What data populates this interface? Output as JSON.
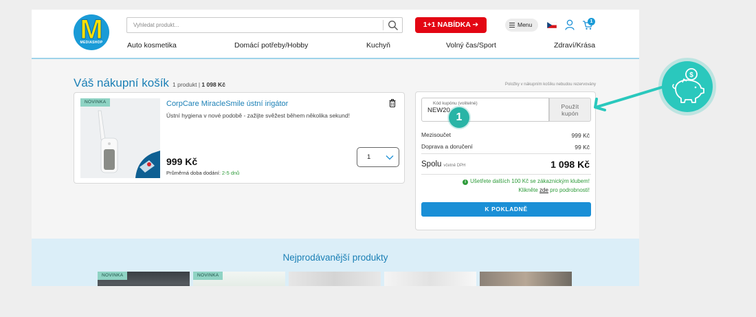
{
  "logo": {
    "letter": "M",
    "sub": "MEDIASHOP"
  },
  "search": {
    "placeholder": "Vyhledat produkt..."
  },
  "promo_label": "1+1 NABÍDKA ➔",
  "menu_label": "Menu",
  "cart_count": "1",
  "nav": [
    "Auto kosmetika",
    "Domácí potřeby/Hobby",
    "Kuchyň",
    "Volný čas/Sport",
    "Zdraví/Krása"
  ],
  "cart": {
    "title": "Váš nákupní košík",
    "count_text": "1 produkt",
    "count_sep": "|",
    "count_price": "1 098 Kč",
    "reserve_note": "Položky v nákupním košíku nebudou rezervovány"
  },
  "product": {
    "badge": "NOVINKA",
    "name": "CorpCare MiracleSmile ústní irigátor",
    "description": "Ústní hygiena v nové podobě - zažijte svěžest během několika sekund!",
    "price": "999 Kč",
    "delivery_label": "Průměrná doba dodání:",
    "delivery_value": "2-5 dnů",
    "quantity": "1"
  },
  "summary": {
    "coupon_label": "Kód kupónu (volitelné)",
    "coupon_value": "NEW20",
    "coupon_button_line1": "Použít",
    "coupon_button_line2": "kupón",
    "step_number": "1",
    "subtotal_label": "Mezisoučet",
    "subtotal_value": "999 Kč",
    "shipping_label": "Doprava a doručení",
    "shipping_value": "99 Kč",
    "total_label": "Spolu",
    "total_note": "včetně DPH",
    "total_value": "1 098 Kč",
    "club_line1": "Ušetřete dalších 100 Kč se zákaznickým klubem!",
    "club_line2_pre": "Klikněte",
    "club_line2_link": "zde",
    "club_line2_post": "pro podrobnosti!",
    "checkout_label": "K POKLADNĚ"
  },
  "bestsellers": {
    "title": "Nejprodávanější produkty",
    "badges": [
      "NOVINKA",
      "NOVINKA"
    ]
  },
  "colors": {
    "brand_blue": "#1a7fb5",
    "promo_red": "#e30613",
    "checkout_blue": "#1a8fd6",
    "teal_accent": "#2ac8bd",
    "success_green": "#2e9b3a"
  }
}
